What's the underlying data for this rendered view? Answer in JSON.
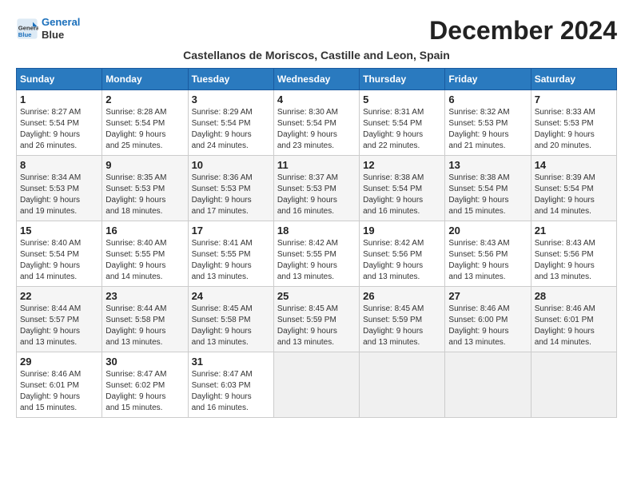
{
  "header": {
    "logo_line1": "General",
    "logo_line2": "Blue",
    "month_year": "December 2024",
    "subtitle": "Castellanos de Moriscos, Castille and Leon, Spain"
  },
  "weekdays": [
    "Sunday",
    "Monday",
    "Tuesday",
    "Wednesday",
    "Thursday",
    "Friday",
    "Saturday"
  ],
  "weeks": [
    [
      {
        "day": "1",
        "info": "Sunrise: 8:27 AM\nSunset: 5:54 PM\nDaylight: 9 hours\nand 26 minutes."
      },
      {
        "day": "2",
        "info": "Sunrise: 8:28 AM\nSunset: 5:54 PM\nDaylight: 9 hours\nand 25 minutes."
      },
      {
        "day": "3",
        "info": "Sunrise: 8:29 AM\nSunset: 5:54 PM\nDaylight: 9 hours\nand 24 minutes."
      },
      {
        "day": "4",
        "info": "Sunrise: 8:30 AM\nSunset: 5:54 PM\nDaylight: 9 hours\nand 23 minutes."
      },
      {
        "day": "5",
        "info": "Sunrise: 8:31 AM\nSunset: 5:54 PM\nDaylight: 9 hours\nand 22 minutes."
      },
      {
        "day": "6",
        "info": "Sunrise: 8:32 AM\nSunset: 5:53 PM\nDaylight: 9 hours\nand 21 minutes."
      },
      {
        "day": "7",
        "info": "Sunrise: 8:33 AM\nSunset: 5:53 PM\nDaylight: 9 hours\nand 20 minutes."
      }
    ],
    [
      {
        "day": "8",
        "info": "Sunrise: 8:34 AM\nSunset: 5:53 PM\nDaylight: 9 hours\nand 19 minutes."
      },
      {
        "day": "9",
        "info": "Sunrise: 8:35 AM\nSunset: 5:53 PM\nDaylight: 9 hours\nand 18 minutes."
      },
      {
        "day": "10",
        "info": "Sunrise: 8:36 AM\nSunset: 5:53 PM\nDaylight: 9 hours\nand 17 minutes."
      },
      {
        "day": "11",
        "info": "Sunrise: 8:37 AM\nSunset: 5:53 PM\nDaylight: 9 hours\nand 16 minutes."
      },
      {
        "day": "12",
        "info": "Sunrise: 8:38 AM\nSunset: 5:54 PM\nDaylight: 9 hours\nand 16 minutes."
      },
      {
        "day": "13",
        "info": "Sunrise: 8:38 AM\nSunset: 5:54 PM\nDaylight: 9 hours\nand 15 minutes."
      },
      {
        "day": "14",
        "info": "Sunrise: 8:39 AM\nSunset: 5:54 PM\nDaylight: 9 hours\nand 14 minutes."
      }
    ],
    [
      {
        "day": "15",
        "info": "Sunrise: 8:40 AM\nSunset: 5:54 PM\nDaylight: 9 hours\nand 14 minutes."
      },
      {
        "day": "16",
        "info": "Sunrise: 8:40 AM\nSunset: 5:55 PM\nDaylight: 9 hours\nand 14 minutes."
      },
      {
        "day": "17",
        "info": "Sunrise: 8:41 AM\nSunset: 5:55 PM\nDaylight: 9 hours\nand 13 minutes."
      },
      {
        "day": "18",
        "info": "Sunrise: 8:42 AM\nSunset: 5:55 PM\nDaylight: 9 hours\nand 13 minutes."
      },
      {
        "day": "19",
        "info": "Sunrise: 8:42 AM\nSunset: 5:56 PM\nDaylight: 9 hours\nand 13 minutes."
      },
      {
        "day": "20",
        "info": "Sunrise: 8:43 AM\nSunset: 5:56 PM\nDaylight: 9 hours\nand 13 minutes."
      },
      {
        "day": "21",
        "info": "Sunrise: 8:43 AM\nSunset: 5:56 PM\nDaylight: 9 hours\nand 13 minutes."
      }
    ],
    [
      {
        "day": "22",
        "info": "Sunrise: 8:44 AM\nSunset: 5:57 PM\nDaylight: 9 hours\nand 13 minutes."
      },
      {
        "day": "23",
        "info": "Sunrise: 8:44 AM\nSunset: 5:58 PM\nDaylight: 9 hours\nand 13 minutes."
      },
      {
        "day": "24",
        "info": "Sunrise: 8:45 AM\nSunset: 5:58 PM\nDaylight: 9 hours\nand 13 minutes."
      },
      {
        "day": "25",
        "info": "Sunrise: 8:45 AM\nSunset: 5:59 PM\nDaylight: 9 hours\nand 13 minutes."
      },
      {
        "day": "26",
        "info": "Sunrise: 8:45 AM\nSunset: 5:59 PM\nDaylight: 9 hours\nand 13 minutes."
      },
      {
        "day": "27",
        "info": "Sunrise: 8:46 AM\nSunset: 6:00 PM\nDaylight: 9 hours\nand 13 minutes."
      },
      {
        "day": "28",
        "info": "Sunrise: 8:46 AM\nSunset: 6:01 PM\nDaylight: 9 hours\nand 14 minutes."
      }
    ],
    [
      {
        "day": "29",
        "info": "Sunrise: 8:46 AM\nSunset: 6:01 PM\nDaylight: 9 hours\nand 15 minutes."
      },
      {
        "day": "30",
        "info": "Sunrise: 8:47 AM\nSunset: 6:02 PM\nDaylight: 9 hours\nand 15 minutes."
      },
      {
        "day": "31",
        "info": "Sunrise: 8:47 AM\nSunset: 6:03 PM\nDaylight: 9 hours\nand 16 minutes."
      },
      {
        "day": "",
        "info": ""
      },
      {
        "day": "",
        "info": ""
      },
      {
        "day": "",
        "info": ""
      },
      {
        "day": "",
        "info": ""
      }
    ]
  ]
}
